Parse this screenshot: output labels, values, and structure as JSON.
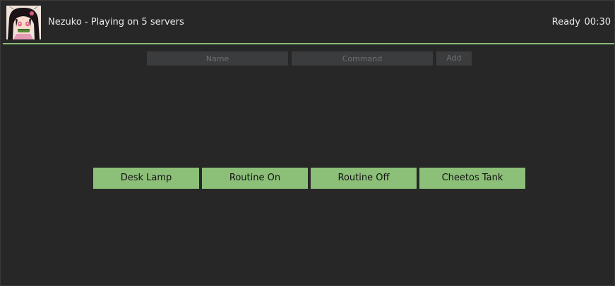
{
  "header": {
    "title": "Nezuko - Playing on 5 servers",
    "status": "Ready",
    "time": "00:30"
  },
  "form": {
    "name_placeholder": "Name",
    "command_placeholder": "Command",
    "add_label": "Add"
  },
  "commands": [
    {
      "label": "Desk Lamp"
    },
    {
      "label": "Routine On"
    },
    {
      "label": "Routine Off"
    },
    {
      "label": "Cheetos Tank"
    }
  ],
  "colors": {
    "accent": "#8cbf78",
    "background": "#272727",
    "input": "#3a3c3e"
  }
}
